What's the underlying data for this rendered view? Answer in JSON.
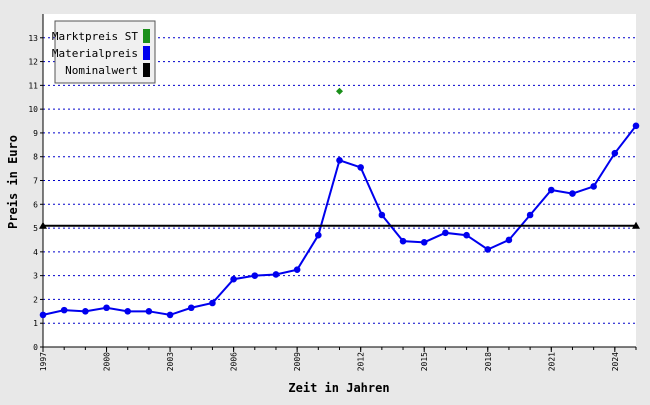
{
  "chart_data": {
    "type": "line",
    "title": "",
    "xlabel": "Zeit in Jahren",
    "ylabel": "Preis in Euro",
    "xlim": [
      1997,
      2025
    ],
    "ylim": [
      0,
      14
    ],
    "x_ticks": [
      "1997",
      "2000",
      "2003",
      "2006",
      "2009",
      "2012",
      "2015",
      "2018",
      "2021",
      "2024"
    ],
    "y_ticks": [
      "0",
      "1",
      "2",
      "3",
      "4",
      "5",
      "6",
      "7",
      "8",
      "9",
      "10",
      "11",
      "12",
      "13"
    ],
    "grid": true,
    "legend_position": "top-left",
    "legend": [
      {
        "label": "Marktpreis ST",
        "color": "#1a8f1a"
      },
      {
        "label": "Materialpreis",
        "color": "#0000ee"
      },
      {
        "label": "Nominalwert",
        "color": "#000000"
      }
    ],
    "series": [
      {
        "name": "Marktpreis ST",
        "kind": "points",
        "color": "#1a8f1a",
        "points": [
          [
            2011,
            10.75
          ]
        ]
      },
      {
        "name": "Materialpreis",
        "kind": "line",
        "color": "#0000ee",
        "points": [
          [
            1997,
            1.35
          ],
          [
            1998,
            1.55
          ],
          [
            1999,
            1.5
          ],
          [
            2000,
            1.65
          ],
          [
            2001,
            1.5
          ],
          [
            2002,
            1.5
          ],
          [
            2003,
            1.35
          ],
          [
            2004,
            1.65
          ],
          [
            2005,
            1.85
          ],
          [
            2006,
            2.85
          ],
          [
            2007,
            3.0
          ],
          [
            2008,
            3.05
          ],
          [
            2009,
            3.25
          ],
          [
            2010,
            4.7
          ],
          [
            2011,
            7.85
          ],
          [
            2012,
            7.55
          ],
          [
            2013,
            5.55
          ],
          [
            2014,
            4.45
          ],
          [
            2015,
            4.4
          ],
          [
            2016,
            4.8
          ],
          [
            2017,
            4.7
          ],
          [
            2018,
            4.1
          ],
          [
            2019,
            4.5
          ],
          [
            2020,
            5.55
          ],
          [
            2021,
            6.6
          ],
          [
            2022,
            6.45
          ],
          [
            2023,
            6.75
          ],
          [
            2024,
            8.15
          ],
          [
            2025,
            9.3
          ]
        ]
      },
      {
        "name": "Nominalwert",
        "kind": "line",
        "color": "#000000",
        "points": [
          [
            1997,
            5.1
          ],
          [
            2025,
            5.1
          ]
        ]
      }
    ]
  }
}
